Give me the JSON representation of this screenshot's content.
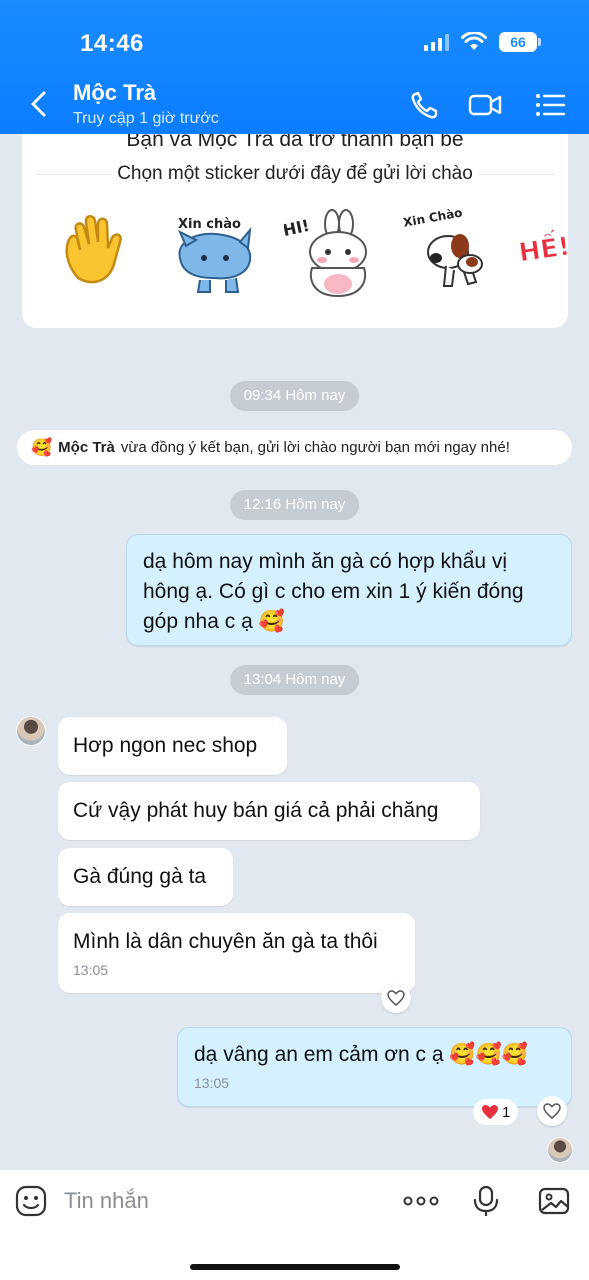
{
  "status": {
    "time": "14:46",
    "battery": "66"
  },
  "header": {
    "title": "Mộc Trà",
    "subtitle": "Truy cập 1 giờ trước"
  },
  "sticker_card": {
    "heading": "Bạn và Mộc Trà đã trở thành bạn bè",
    "subheading": "Chọn một sticker dưới đây để gửi lời chào",
    "stickers": [
      {
        "icon": "waving-hand-sticker"
      },
      {
        "icon": "cat-sticker",
        "text": "Xin chào"
      },
      {
        "icon": "bunny-sticker",
        "text": "HI!"
      },
      {
        "icon": "dog-sticker",
        "text": "Xin Chào"
      },
      {
        "icon": "he-sticker",
        "text": "HẾ!!"
      }
    ]
  },
  "timestamps": {
    "t1": "09:34 Hôm nay",
    "t2": "12:16 Hôm nay",
    "t3": "13:04 Hôm nay"
  },
  "notice": {
    "name": "Mộc Trà",
    "text": "vừa đồng ý kết bạn, gửi lời chào người bạn mới ngay nhé!"
  },
  "messages": [
    {
      "from": "me",
      "text": "dạ hôm nay mình ăn gà có hợp khẩu vị hông ạ. Có gì c cho em xin 1 ý kiến đóng góp nha c ạ 🥰"
    },
    {
      "from": "them",
      "text": "Hơp ngon nec shop"
    },
    {
      "from": "them",
      "text": "Cứ vậy phát huy bán giá cả phải chăng"
    },
    {
      "from": "them",
      "text": "Gà đúng gà ta"
    },
    {
      "from": "them",
      "text": "Mình là dân chuyên ăn gà ta thôi",
      "time": "13:05"
    },
    {
      "from": "me",
      "text": "dạ vâng an em cảm ơn c ạ 🥰🥰🥰",
      "time": "13:05",
      "reactions": "1"
    }
  ],
  "input": {
    "placeholder": "Tin nhắn"
  },
  "colors": {
    "header": "#0b7dff",
    "bubble_me": "#d5f0ff",
    "background": "#e2e8f0"
  }
}
